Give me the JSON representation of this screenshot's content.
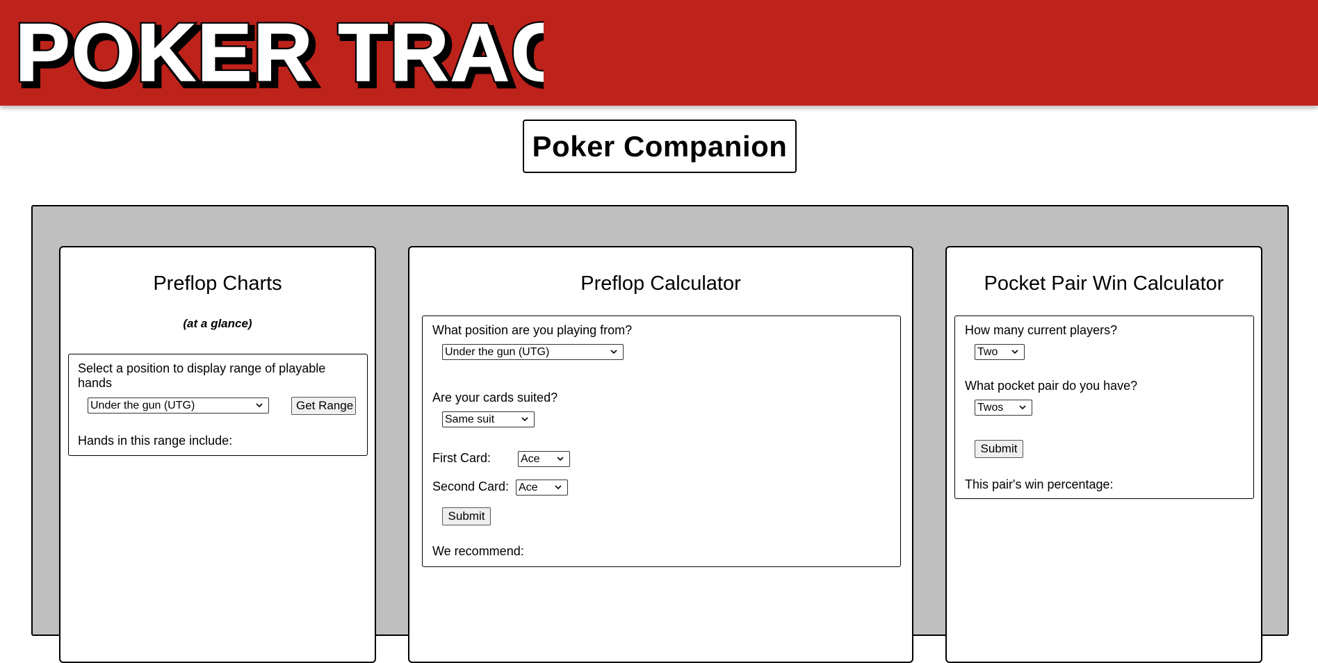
{
  "header": {
    "logo_text": "POKER TRACKER",
    "brand_color": "#bd221b"
  },
  "page_title": "Poker Companion",
  "preflop_charts": {
    "title": "Preflop Charts",
    "subtitle": "(at a glance)",
    "prompt": "Select a position to display range of playable hands",
    "position_value": "Under the gun (UTG)",
    "button_label": "Get Range",
    "result_label": "Hands in this range include:"
  },
  "preflop_calculator": {
    "title": "Preflop Calculator",
    "position_label": "What position are you playing from?",
    "position_value": "Under the gun (UTG)",
    "suited_label": "Are your cards suited?",
    "suited_value": "Same suit",
    "first_card_label": "First Card:",
    "first_card_value": "Ace",
    "second_card_label": "Second Card:",
    "second_card_value": "Ace",
    "submit_label": "Submit",
    "result_label": "We recommend:"
  },
  "pocket_pair": {
    "title": "Pocket Pair Win Calculator",
    "players_label": "How many current players?",
    "players_value": "Two",
    "pair_label": "What pocket pair do you have?",
    "pair_value": "Twos",
    "submit_label": "Submit",
    "result_label": "This pair's win percentage:"
  }
}
